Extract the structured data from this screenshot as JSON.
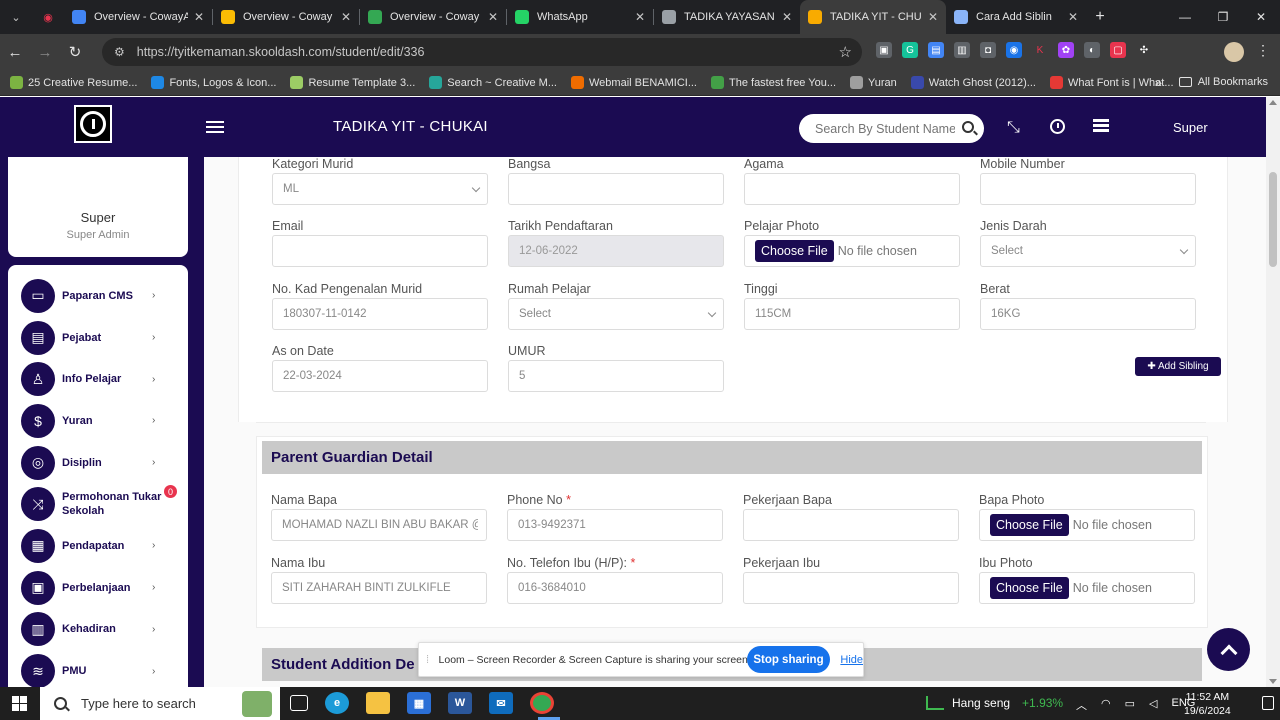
{
  "browser": {
    "tabs": [
      {
        "title": "Overview - CowayA",
        "fav": "#4285f4",
        "active": false
      },
      {
        "title": "Overview - Coway C",
        "fav": "#fbbc04",
        "active": false
      },
      {
        "title": "Overview - Coway P",
        "fav": "#34a853",
        "active": false
      },
      {
        "title": "WhatsApp",
        "fav": "#25d366",
        "active": false
      },
      {
        "title": "TADIKA YAYASAN IS",
        "fav": "#9aa0a6",
        "active": false
      },
      {
        "title": "TADIKA YIT - CHUK",
        "fav": "#f9ab00",
        "active": true
      },
      {
        "title": "Cara Add Siblin",
        "fav": "#8ab4f8",
        "active": false
      }
    ],
    "url": "https://tyitkemaman.skooldash.com/student/edit/336",
    "bookmarks": [
      {
        "label": "25 Creative Resume...",
        "color": "#7cb342"
      },
      {
        "label": "Fonts, Logos & Icon...",
        "color": "#1e88e5"
      },
      {
        "label": "Resume Template 3...",
        "color": "#9ccc65"
      },
      {
        "label": "Search ~ Creative M...",
        "color": "#26a69a"
      },
      {
        "label": "Webmail BENAMICI...",
        "color": "#ef6c00"
      },
      {
        "label": "The fastest free You...",
        "color": "#43a047"
      },
      {
        "label": "Yuran",
        "color": "#9e9e9e"
      },
      {
        "label": "Watch Ghost (2012)...",
        "color": "#3949ab"
      },
      {
        "label": "What Font is | What...",
        "color": "#e53935"
      }
    ],
    "all_bookmarks": "All Bookmarks"
  },
  "header": {
    "school_name": "TADIKA YIT - CHUKAI",
    "search_placeholder": "Search By Student Name",
    "user": "Super"
  },
  "sidebar": {
    "user_name": "Super",
    "user_role": "Super Admin",
    "items": [
      {
        "label": "Paparan CMS",
        "icon": "monitor-icon",
        "glyph": "▭"
      },
      {
        "label": "Pejabat",
        "icon": "briefcase-icon",
        "glyph": "▤"
      },
      {
        "label": "Info Pelajar",
        "icon": "student-icon",
        "glyph": "♙"
      },
      {
        "label": "Yuran",
        "icon": "hand-coin-icon",
        "glyph": "$"
      },
      {
        "label": "Disiplin",
        "icon": "target-icon",
        "glyph": "◎"
      },
      {
        "label": "Permohonan Tukar Sekolah",
        "icon": "shuffle-icon",
        "glyph": "⤨",
        "badge": "0"
      },
      {
        "label": "Pendapatan",
        "icon": "money-stack-icon",
        "glyph": "▦"
      },
      {
        "label": "Perbelanjaan",
        "icon": "wallet-icon",
        "glyph": "▣"
      },
      {
        "label": "Kehadiran",
        "icon": "calendar-icon",
        "glyph": "▥"
      },
      {
        "label": "PMU",
        "icon": "pmu-icon",
        "glyph": "≋"
      }
    ]
  },
  "student": {
    "kategori_murid": {
      "label": "Kategori Murid",
      "value": "ML"
    },
    "bangsa": {
      "label": "Bangsa",
      "value": ""
    },
    "agama": {
      "label": "Agama",
      "value": ""
    },
    "mobile": {
      "label": "Mobile Number",
      "value": ""
    },
    "email": {
      "label": "Email",
      "value": ""
    },
    "tarikh": {
      "label": "Tarikh Pendaftaran",
      "value": "12-06-2022"
    },
    "photo": {
      "label": "Pelajar Photo",
      "button": "Choose File",
      "status": "No file chosen"
    },
    "jenis_darah": {
      "label": "Jenis Darah",
      "value": "Select"
    },
    "ic": {
      "label": "No. Kad Pengenalan Murid",
      "value": "180307-11-0142"
    },
    "rumah": {
      "label": "Rumah Pelajar",
      "value": "Select"
    },
    "tinggi": {
      "label": "Tinggi",
      "value": "115CM"
    },
    "berat": {
      "label": "Berat",
      "value": "16KG"
    },
    "as_on_date": {
      "label": "As on Date",
      "value": "22-03-2024"
    },
    "umur": {
      "label": "UMUR",
      "value": "5"
    },
    "add_sibling": "✚ Add Sibling"
  },
  "parent": {
    "title": "Parent Guardian Detail",
    "nama_bapa": {
      "label": "Nama Bapa",
      "value": "MOHAMAD NAZLI BIN ABU BAKAR @"
    },
    "phone": {
      "label": "Phone No",
      "value": "013-9492371"
    },
    "pekerjaan_bapa": {
      "label": "Pekerjaan Bapa",
      "value": ""
    },
    "bapa_photo": {
      "label": "Bapa Photo",
      "button": "Choose File",
      "status": "No file chosen"
    },
    "nama_ibu": {
      "label": "Nama Ibu",
      "value": "SITI ZAHARAH BINTI ZULKIFLE"
    },
    "telefon_ibu": {
      "label": "No. Telefon Ibu (H/P):",
      "value": "016-3684010"
    },
    "pekerjaan_ibu": {
      "label": "Pekerjaan Ibu",
      "value": ""
    },
    "ibu_photo": {
      "label": "Ibu Photo",
      "button": "Choose File",
      "status": "No file chosen"
    },
    "required_mark": "*"
  },
  "next_section": {
    "title": "Student Addition De"
  },
  "loom": {
    "message": "Loom – Screen Recorder & Screen Capture is sharing your screen.",
    "stop": "Stop sharing",
    "hide": "Hide"
  },
  "taskbar": {
    "search_text": "Type here to search",
    "ticker_name": "Hang seng",
    "ticker_change": "+1.93%",
    "lang": "ENG",
    "time": "11:52 AM",
    "date": "19/6/2024"
  }
}
